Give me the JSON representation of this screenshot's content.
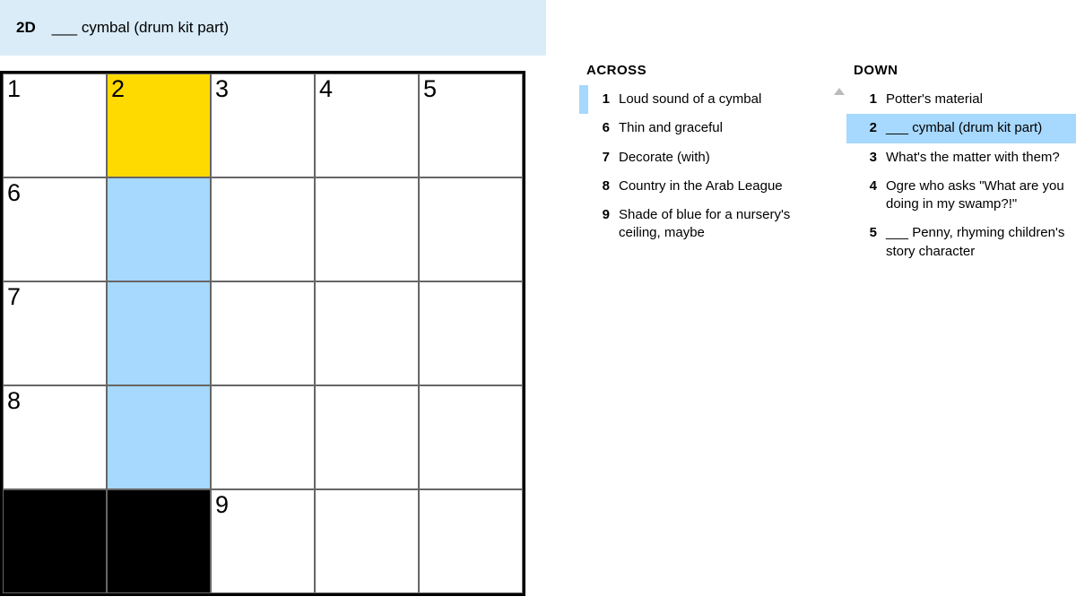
{
  "current_clue": {
    "id": "2D",
    "text": "___ cymbal (drum kit part)"
  },
  "grid": {
    "size": 5,
    "cells": [
      [
        {
          "n": "1"
        },
        {
          "n": "2",
          "cursor": true
        },
        {
          "n": "3"
        },
        {
          "n": "4"
        },
        {
          "n": "5"
        }
      ],
      [
        {
          "n": "6"
        },
        {
          "hl": true
        },
        {},
        {},
        {}
      ],
      [
        {
          "n": "7"
        },
        {
          "hl": true
        },
        {},
        {},
        {}
      ],
      [
        {
          "n": "8"
        },
        {
          "hl": true
        },
        {},
        {},
        {}
      ],
      [
        {
          "black": true
        },
        {
          "black": true
        },
        {
          "n": "9"
        },
        {},
        {}
      ]
    ]
  },
  "clues": {
    "across_label": "ACROSS",
    "down_label": "DOWN",
    "across": [
      {
        "n": "1",
        "t": "Loud sound of a cymbal",
        "related": true
      },
      {
        "n": "6",
        "t": "Thin and graceful"
      },
      {
        "n": "7",
        "t": "Decorate (with)"
      },
      {
        "n": "8",
        "t": "Country in the Arab League"
      },
      {
        "n": "9",
        "t": "Shade of blue for a nursery's ceiling, maybe"
      }
    ],
    "down": [
      {
        "n": "1",
        "t": "Potter's material"
      },
      {
        "n": "2",
        "t": "___ cymbal (drum kit part)",
        "sel": true
      },
      {
        "n": "3",
        "t": "What's the matter with them?"
      },
      {
        "n": "4",
        "t": "Ogre who asks \"What are you doing in my swamp?!\""
      },
      {
        "n": "5",
        "t": "___ Penny, rhyming children's story character"
      }
    ]
  }
}
